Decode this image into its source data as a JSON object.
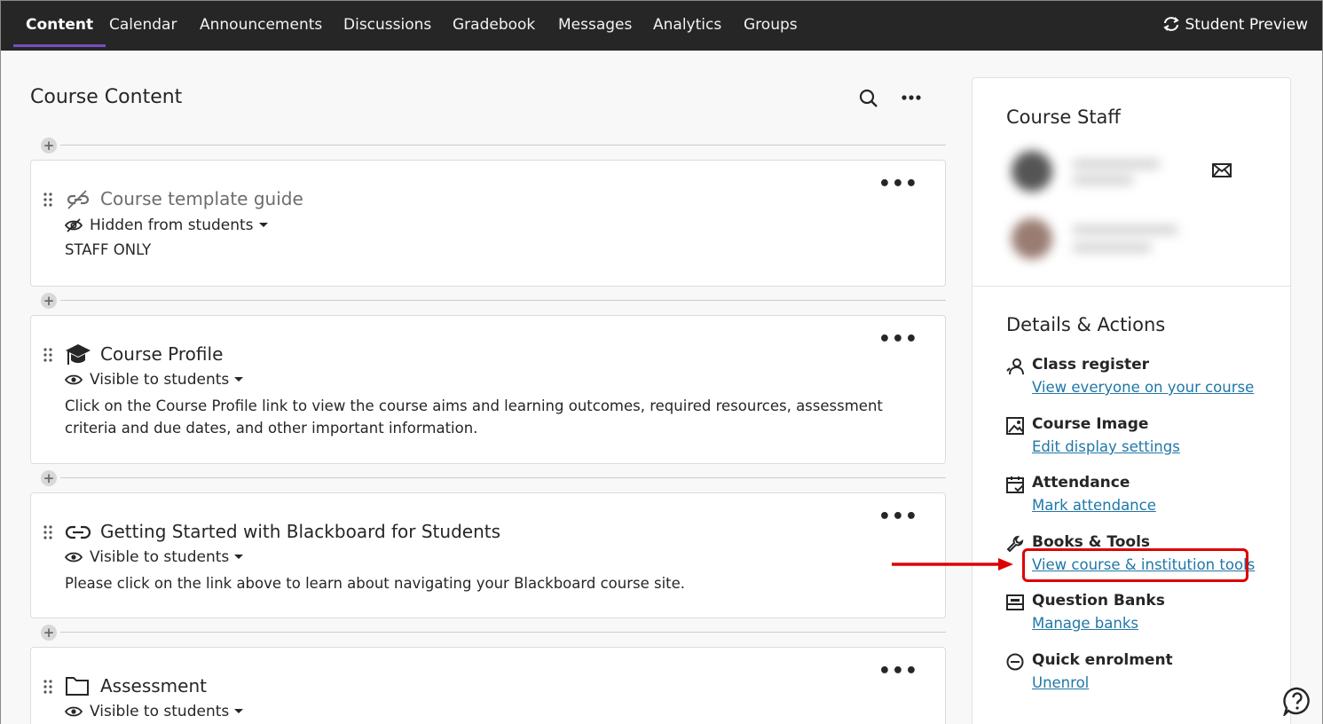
{
  "nav": {
    "tabs": [
      "Content",
      "Calendar",
      "Announcements",
      "Discussions",
      "Gradebook",
      "Messages",
      "Analytics",
      "Groups"
    ],
    "active_tab": "Content",
    "student_preview": "Student Preview",
    "accent_color": "#7650c0"
  },
  "course_content": {
    "title": "Course Content",
    "items": [
      {
        "title": "Course template guide",
        "icon": "link-off-icon",
        "visibility": "Hidden from students",
        "description": "STAFF ONLY"
      },
      {
        "title": "Course Profile",
        "icon": "graduation-cap-icon",
        "visibility": "Visible to students",
        "description": "Click on the Course Profile link to view the course aims and learning outcomes, required resources, assessment criteria and due dates, and other important information."
      },
      {
        "title": "Getting Started with Blackboard for Students",
        "icon": "link-icon",
        "visibility": "Visible to students",
        "description": "Please click on the link above to learn about navigating your Blackboard course site."
      },
      {
        "title": "Assessment",
        "icon": "folder-icon",
        "visibility": "Visible to students",
        "description": ""
      }
    ]
  },
  "panel": {
    "staff_title": "Course Staff",
    "details_title": "Details & Actions",
    "actions": [
      {
        "title": "Class register",
        "link": "View everyone on your course",
        "icon": "people-icon"
      },
      {
        "title": "Course Image",
        "link": "Edit display settings",
        "icon": "image-icon"
      },
      {
        "title": "Attendance",
        "link": "Mark attendance",
        "icon": "calendar-check-icon"
      },
      {
        "title": "Books & Tools",
        "link": "View course & institution tools",
        "icon": "wrench-icon"
      },
      {
        "title": "Question Banks",
        "link": "Manage banks",
        "icon": "bank-icon"
      },
      {
        "title": "Quick enrolment",
        "link": "Unenrol",
        "icon": "minus-circle-icon"
      }
    ],
    "link_color": "#1f77a8"
  },
  "annotation": {
    "highlight_color": "#dd0000"
  }
}
